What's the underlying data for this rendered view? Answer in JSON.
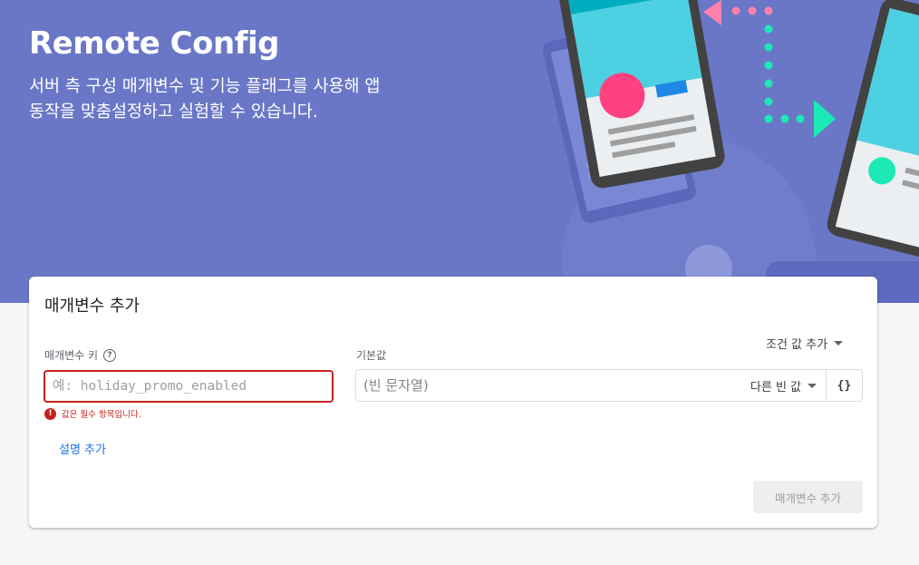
{
  "hero": {
    "title": "Remote Config",
    "subtitle": "서버 측 구성 매개변수 및 기능 플래그를 사용해 앱 동작을 맞춤설정하고 실험할 수 있습니다."
  },
  "dialog": {
    "title": "매개변수 추가",
    "param_key": {
      "label": "매개변수 키",
      "placeholder": "예: holiday_promo_enabled",
      "value": "",
      "error": "값은 필수 항목입니다."
    },
    "add_description": "설명 추가",
    "default_value": {
      "label": "기본값",
      "placeholder": "(빈 문자열)",
      "value": "",
      "type_selector": "다른 빈 값",
      "json_button": "{}"
    },
    "add_condition": "조건 값 추가",
    "submit_button": "매개변수 추가"
  },
  "colors": {
    "hero_bg": "#6a77c7",
    "error": "#c5221f",
    "link": "#1a73e8"
  },
  "icons": [
    "help-circle-icon",
    "error-icon",
    "dropdown-caret-icon",
    "json-braces-icon"
  ]
}
